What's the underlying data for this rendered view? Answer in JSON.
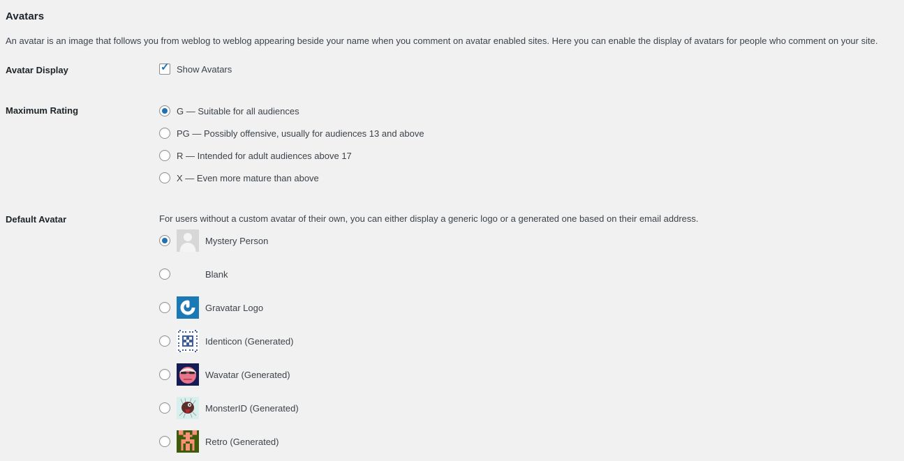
{
  "heading": "Avatars",
  "description": "An avatar is an image that follows you from weblog to weblog appearing beside your name when you comment on avatar enabled sites. Here you can enable the display of avatars for people who comment on your site.",
  "avatar_display": {
    "label": "Avatar Display",
    "checkbox_label": "Show Avatars",
    "checked": true
  },
  "maximum_rating": {
    "label": "Maximum Rating",
    "selected": "G",
    "options": [
      {
        "value": "G",
        "label": "G — Suitable for all audiences",
        "checked": true
      },
      {
        "value": "PG",
        "label": "PG — Possibly offensive, usually for audiences 13 and above",
        "checked": false
      },
      {
        "value": "R",
        "label": "R — Intended for adult audiences above 17",
        "checked": false
      },
      {
        "value": "X",
        "label": "X — Even more mature than above",
        "checked": false
      }
    ]
  },
  "default_avatar": {
    "label": "Default Avatar",
    "description": "For users without a custom avatar of their own, you can either display a generic logo or a generated one based on their email address.",
    "selected": "mystery",
    "options": [
      {
        "value": "mystery",
        "label": "Mystery Person",
        "checked": true,
        "icon": "mystery-person-avatar"
      },
      {
        "value": "blank",
        "label": "Blank",
        "checked": false,
        "icon": "blank-avatar"
      },
      {
        "value": "gravatar",
        "label": "Gravatar Logo",
        "checked": false,
        "icon": "gravatar-logo-avatar"
      },
      {
        "value": "identicon",
        "label": "Identicon (Generated)",
        "checked": false,
        "icon": "identicon-avatar"
      },
      {
        "value": "wavatar",
        "label": "Wavatar (Generated)",
        "checked": false,
        "icon": "wavatar-avatar"
      },
      {
        "value": "monsterid",
        "label": "MonsterID (Generated)",
        "checked": false,
        "icon": "monsterid-avatar"
      },
      {
        "value": "retro",
        "label": "Retro (Generated)",
        "checked": false,
        "icon": "retro-avatar"
      }
    ]
  },
  "colors": {
    "background": "#f1f1f1",
    "text": "#3c434a",
    "heading": "#1d2327",
    "accent": "#2271b1",
    "gravatar_blue": "#1b79b6",
    "wavatar_bg": "#151b54",
    "monster_bg": "#d7f0ee",
    "retro_bg": "#3f5b09"
  }
}
